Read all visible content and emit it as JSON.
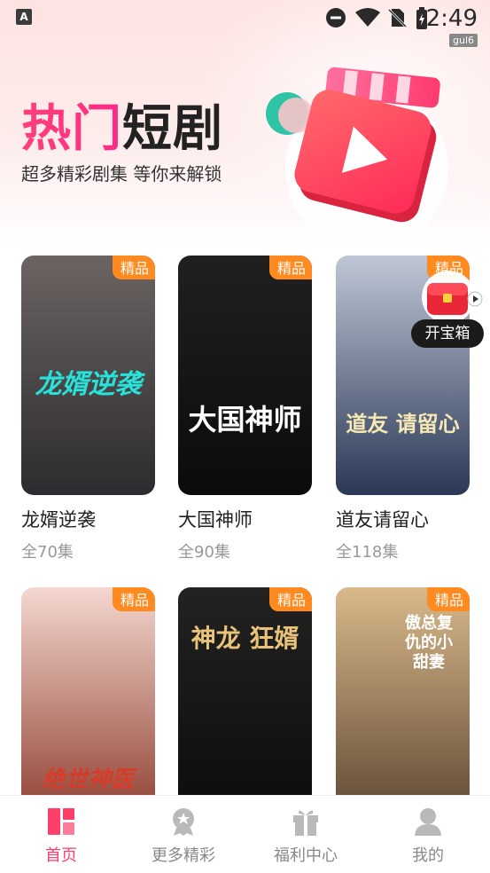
{
  "status_bar": {
    "time": "2:49",
    "tag": "gul6"
  },
  "hero": {
    "title_part1": "热门",
    "title_part2": "短剧",
    "subtitle": "超多精彩剧集 等你来解锁"
  },
  "badge_label": "精品",
  "treasure": {
    "label": "开宝箱"
  },
  "cards": [
    {
      "title": "龙婿逆袭",
      "count": "全70集",
      "poster_text": "龙婿逆袭",
      "poster_colors": [
        "#6b6462",
        "#2d2b2f"
      ],
      "text_color": "#28e1d8"
    },
    {
      "title": "大国神师",
      "count": "全90集",
      "poster_text": "大国神师",
      "poster_colors": [
        "#202020",
        "#0b0b0b"
      ],
      "text_color": "#ffffff"
    },
    {
      "title": "道友请留心",
      "count": "全118集",
      "poster_text": "道友 请留心",
      "poster_colors": [
        "#bfc7d6",
        "#2a3855"
      ],
      "text_color": "#f6e8b5"
    },
    {
      "title": "",
      "count": "",
      "poster_text": "绝世神医",
      "poster_colors": [
        "#f4d7cf",
        "#8c3b2c"
      ],
      "text_color": "#d63c2a"
    },
    {
      "title": "",
      "count": "",
      "poster_text": "神龙 狂婿",
      "poster_colors": [
        "#222",
        "#0b0b0b"
      ],
      "text_color": "#e9c27a"
    },
    {
      "title": "",
      "count": "",
      "poster_text": "傲总复仇的小甜妻",
      "poster_colors": [
        "#d9b98b",
        "#5b4530"
      ],
      "text_color": "#ffffff"
    }
  ],
  "tabs": [
    {
      "label": "首页",
      "icon": "home-grid-icon",
      "active": true
    },
    {
      "label": "更多精彩",
      "icon": "medal-icon",
      "active": false
    },
    {
      "label": "福利中心",
      "icon": "gift-icon",
      "active": false
    },
    {
      "label": "我的",
      "icon": "user-icon",
      "active": false
    }
  ],
  "colors": {
    "accent": "#ff3e6a",
    "badge": "#ff8a1f"
  }
}
